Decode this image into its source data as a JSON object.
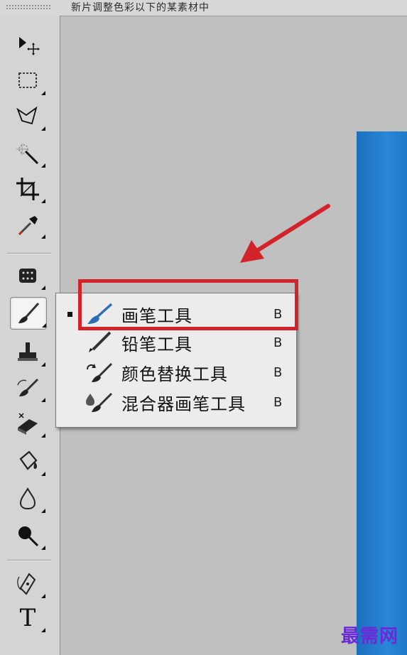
{
  "document_tab": {
    "title": "新片调整色彩以下的某素材中"
  },
  "toolbar": {
    "tools": [
      {
        "name": "move-tool",
        "icon": "move-icon"
      },
      {
        "name": "marquee-tool",
        "icon": "rect-marquee-icon"
      },
      {
        "name": "lasso-tool",
        "icon": "polygon-lasso-icon"
      },
      {
        "name": "magic-wand-tool",
        "icon": "magic-wand-icon"
      },
      {
        "name": "crop-tool",
        "icon": "crop-icon"
      },
      {
        "name": "eyedropper-tool",
        "icon": "eyedropper-icon"
      },
      {
        "name": "healing-tool",
        "icon": "healing-patch-icon"
      },
      {
        "name": "brush-tool",
        "icon": "brush-icon",
        "active": true
      },
      {
        "name": "stamp-tool",
        "icon": "stamp-icon"
      },
      {
        "name": "history-brush-tool",
        "icon": "history-brush-icon"
      },
      {
        "name": "eraser-tool",
        "icon": "eraser-icon"
      },
      {
        "name": "paint-bucket-tool",
        "icon": "paint-bucket-icon"
      },
      {
        "name": "blur-tool",
        "icon": "blur-drop-icon"
      },
      {
        "name": "dodge-tool",
        "icon": "dodge-icon"
      },
      {
        "name": "pen-tool",
        "icon": "pen-icon"
      },
      {
        "name": "type-tool",
        "icon": "type-icon"
      }
    ],
    "type_tool_label": "T"
  },
  "flyout_menu": {
    "items": [
      {
        "label": "画笔工具",
        "shortcut": "B",
        "selected": true,
        "icon": "brush-icon"
      },
      {
        "label": "铅笔工具",
        "shortcut": "B",
        "selected": false,
        "icon": "pencil-icon"
      },
      {
        "label": "颜色替换工具",
        "shortcut": "B",
        "selected": false,
        "icon": "color-replacement-icon"
      },
      {
        "label": "混合器画笔工具",
        "shortcut": "B",
        "selected": false,
        "icon": "mixer-brush-icon"
      }
    ]
  },
  "annotation": {
    "highlight_color": "#d2232a",
    "arrow_color": "#d2232a"
  },
  "watermark": {
    "text": "最需网",
    "color": "#6a2bd6"
  }
}
